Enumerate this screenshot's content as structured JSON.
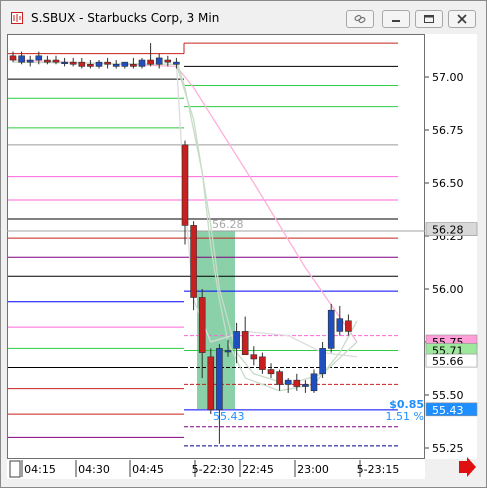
{
  "window": {
    "title": "S.SBUX - Starbucks Corp, 3 Min"
  },
  "icons": {
    "app": "chart-app-icon",
    "link": "link-icon",
    "minimize": "minimize-icon",
    "restore": "restore-icon",
    "close": "close-icon",
    "scroll_right": "arrow-right-icon"
  },
  "colors": {
    "up_candle": "#1f4fbf",
    "down_candle": "#c8201e",
    "highlight": "#3cb371",
    "arrow": "#e01010"
  },
  "price_axis": {
    "ticks": [
      "57.00",
      "56.75",
      "56.50",
      "56.25",
      "56.00",
      "55.75",
      "55.50",
      "55.25"
    ],
    "markers": [
      {
        "label": "56.28",
        "bg": "#d8d8d8",
        "fg": "#000000"
      },
      {
        "label": "55.75",
        "bg": "#ff9ed8",
        "fg": "#000000"
      },
      {
        "label": "55.71",
        "bg": "#9ee89e",
        "fg": "#000000"
      },
      {
        "label": "55.66",
        "bg": "#ffffff",
        "fg": "#000000"
      },
      {
        "label": "55.43",
        "bg": "#1f8fff",
        "fg": "#ffffff"
      }
    ]
  },
  "time_axis": {
    "labels": [
      "04:15",
      "04:30",
      "04:45",
      "5-22:30",
      "22:45",
      "23:00",
      "5-23:15"
    ]
  },
  "annotations": {
    "price_top": "56.28",
    "price_bottom": "55.43",
    "change_abs": "$0.85",
    "change_pct": "1.51 %"
  },
  "chart_data": {
    "type": "candlestick",
    "y_range": [
      55.18,
      57.3
    ],
    "candles": [
      {
        "o": 57.1,
        "h": 57.12,
        "l": 57.07,
        "c": 57.08
      },
      {
        "o": 57.07,
        "h": 57.12,
        "l": 57.06,
        "c": 57.1
      },
      {
        "o": 57.07,
        "h": 57.1,
        "l": 57.05,
        "c": 57.08
      },
      {
        "o": 57.08,
        "h": 57.12,
        "l": 57.06,
        "c": 57.1
      },
      {
        "o": 57.08,
        "h": 57.1,
        "l": 57.06,
        "c": 57.07
      },
      {
        "o": 57.08,
        "h": 57.1,
        "l": 57.06,
        "c": 57.07
      },
      {
        "o": 57.07,
        "h": 57.09,
        "l": 57.05,
        "c": 57.07
      },
      {
        "o": 57.07,
        "h": 57.09,
        "l": 57.05,
        "c": 57.06
      },
      {
        "o": 57.07,
        "h": 57.09,
        "l": 57.04,
        "c": 57.05
      },
      {
        "o": 57.06,
        "h": 57.08,
        "l": 57.04,
        "c": 57.05
      },
      {
        "o": 57.05,
        "h": 57.08,
        "l": 57.04,
        "c": 57.07
      },
      {
        "o": 57.07,
        "h": 57.09,
        "l": 57.04,
        "c": 57.06
      },
      {
        "o": 57.05,
        "h": 57.08,
        "l": 57.04,
        "c": 57.06
      },
      {
        "o": 57.05,
        "h": 57.07,
        "l": 57.04,
        "c": 57.07
      },
      {
        "o": 57.06,
        "h": 57.09,
        "l": 57.04,
        "c": 57.05
      },
      {
        "o": 57.05,
        "h": 57.09,
        "l": 57.04,
        "c": 57.08
      },
      {
        "o": 57.08,
        "h": 57.16,
        "l": 57.05,
        "c": 57.06
      },
      {
        "o": 57.06,
        "h": 57.11,
        "l": 57.04,
        "c": 57.09
      },
      {
        "o": 57.08,
        "h": 57.1,
        "l": 57.05,
        "c": 57.07
      },
      {
        "o": 57.06,
        "h": 57.09,
        "l": 57.04,
        "c": 57.07
      },
      {
        "o": 56.68,
        "h": 56.7,
        "l": 56.21,
        "c": 56.3
      },
      {
        "o": 56.3,
        "h": 56.32,
        "l": 55.9,
        "c": 55.96
      },
      {
        "o": 55.96,
        "h": 56.0,
        "l": 55.58,
        "c": 55.7
      },
      {
        "o": 55.68,
        "h": 55.72,
        "l": 55.41,
        "c": 55.43
      },
      {
        "o": 55.43,
        "h": 55.74,
        "l": 55.27,
        "c": 55.72
      },
      {
        "o": 55.71,
        "h": 55.76,
        "l": 55.68,
        "c": 55.71
      },
      {
        "o": 55.72,
        "h": 55.84,
        "l": 55.65,
        "c": 55.8
      },
      {
        "o": 55.8,
        "h": 55.87,
        "l": 55.69,
        "c": 55.69
      },
      {
        "o": 55.69,
        "h": 55.73,
        "l": 55.64,
        "c": 55.67
      },
      {
        "o": 55.68,
        "h": 55.7,
        "l": 55.6,
        "c": 55.62
      },
      {
        "o": 55.62,
        "h": 55.65,
        "l": 55.58,
        "c": 55.6
      },
      {
        "o": 55.61,
        "h": 55.62,
        "l": 55.52,
        "c": 55.55
      },
      {
        "o": 55.55,
        "h": 55.58,
        "l": 55.51,
        "c": 55.57
      },
      {
        "o": 55.57,
        "h": 55.6,
        "l": 55.52,
        "c": 55.54
      },
      {
        "o": 55.54,
        "h": 55.57,
        "l": 55.51,
        "c": 55.55
      },
      {
        "o": 55.52,
        "h": 55.62,
        "l": 55.51,
        "c": 55.6
      },
      {
        "o": 55.6,
        "h": 55.75,
        "l": 55.58,
        "c": 55.72
      },
      {
        "o": 55.72,
        "h": 55.93,
        "l": 55.7,
        "c": 55.9
      },
      {
        "o": 55.8,
        "h": 55.92,
        "l": 55.78,
        "c": 55.86
      },
      {
        "o": 55.85,
        "h": 55.88,
        "l": 55.78,
        "c": 55.8
      }
    ],
    "levels_left": [
      {
        "price": 57.11,
        "color": "#c8201e"
      },
      {
        "price": 56.99,
        "color": "#000000"
      },
      {
        "price": 56.9,
        "color": "#2ecc40"
      },
      {
        "price": 56.76,
        "color": "#2ecc40"
      },
      {
        "price": 56.68,
        "color": "#9a9a9a"
      },
      {
        "price": 56.53,
        "color": "#ff66dd"
      },
      {
        "price": 56.42,
        "color": "#ff66dd"
      },
      {
        "price": 56.33,
        "color": "#000000"
      },
      {
        "price": 56.24,
        "color": "#c8201e"
      },
      {
        "price": 56.15,
        "color": "#800080"
      },
      {
        "price": 56.06,
        "color": "#000000"
      },
      {
        "price": 55.94,
        "color": "#0000ff"
      },
      {
        "price": 55.82,
        "color": "#ff66dd"
      },
      {
        "price": 55.72,
        "color": "#2ecc40"
      },
      {
        "price": 55.63,
        "color": "#000000"
      },
      {
        "price": 55.53,
        "color": "#c8201e"
      },
      {
        "price": 55.41,
        "color": "#c8201e"
      },
      {
        "price": 55.3,
        "color": "#800080"
      }
    ],
    "levels_right": [
      {
        "price": 57.16,
        "color": "#c8201e"
      },
      {
        "price": 57.05,
        "color": "#000000"
      },
      {
        "price": 56.96,
        "color": "#2ecc40"
      },
      {
        "price": 56.86,
        "color": "#2ecc40"
      },
      {
        "price": 56.68,
        "color": "#9a9a9a"
      },
      {
        "price": 56.53,
        "color": "#ff66dd"
      },
      {
        "price": 56.42,
        "color": "#ff66dd"
      },
      {
        "price": 56.33,
        "color": "#000000"
      },
      {
        "price": 56.24,
        "color": "#c8201e"
      },
      {
        "price": 56.15,
        "color": "#800080"
      },
      {
        "price": 56.06,
        "color": "#000000"
      },
      {
        "price": 55.99,
        "color": "#0000ff"
      },
      {
        "price": 55.78,
        "color": "#ff66dd"
      },
      {
        "price": 55.71,
        "color": "#2ecc40"
      },
      {
        "price": 55.63,
        "color": "#000000"
      },
      {
        "price": 55.55,
        "color": "#c8201e"
      },
      {
        "price": 55.43,
        "color": "#0000ff"
      },
      {
        "price": 55.35,
        "color": "#800080"
      },
      {
        "price": 55.26,
        "color": "#000088"
      }
    ],
    "ma_curves": [
      {
        "color": "#ffb0d8",
        "points": [
          [
            0,
            57.08
          ],
          [
            19,
            57.05
          ],
          [
            21,
            56.95
          ],
          [
            28,
            56.5
          ],
          [
            34,
            56.1
          ],
          [
            40,
            55.75
          ]
        ]
      },
      {
        "color": "#c8dcc8",
        "points": [
          [
            0,
            57.07
          ],
          [
            19,
            57.06
          ],
          [
            21,
            56.8
          ],
          [
            23,
            56.3
          ],
          [
            24,
            56.0
          ],
          [
            26,
            55.7
          ],
          [
            28,
            55.6
          ],
          [
            32,
            55.55
          ],
          [
            36,
            55.6
          ],
          [
            40,
            55.75
          ]
        ]
      },
      {
        "color": "#c8dcc8",
        "points": [
          [
            19,
            57.08
          ],
          [
            20,
            56.95
          ],
          [
            22,
            56.55
          ],
          [
            23,
            56.2
          ],
          [
            24,
            55.95
          ],
          [
            25,
            55.75
          ],
          [
            27,
            55.58
          ],
          [
            31,
            55.52
          ],
          [
            35,
            55.55
          ],
          [
            38,
            55.7
          ],
          [
            40,
            55.85
          ]
        ]
      },
      {
        "color": "#dcdcdc",
        "points": [
          [
            19,
            57.07
          ],
          [
            20,
            56.4
          ],
          [
            21,
            55.95
          ],
          [
            23,
            55.75
          ],
          [
            27,
            55.8
          ],
          [
            32,
            55.78
          ],
          [
            36,
            55.7
          ],
          [
            40,
            55.68
          ]
        ]
      }
    ]
  }
}
